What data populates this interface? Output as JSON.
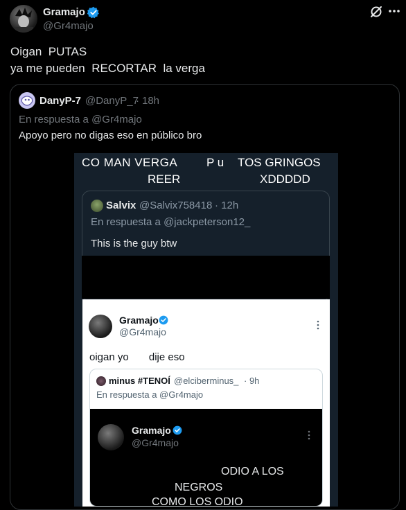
{
  "main_tweet": {
    "author_name": "Gramajo",
    "author_handle": "@Gr4majo",
    "text_line1": "Oigan  PUTAS",
    "text_line2": "ya me pueden  RECORTAR  la verga"
  },
  "quoted_tweet": {
    "author_name": "DanyP-7",
    "author_handle": "@DanyP_7",
    "time_sep": "·",
    "time": "18h",
    "reply_to": "En respuesta a @Gr4majo",
    "text": "Apoyo pero no digas eso en público bro"
  },
  "meme": {
    "caption_left_1": "CO MAN VERGA",
    "caption_left_2": "REER",
    "caption_mid": "P u",
    "caption_right_1": "TOS GRINGOS",
    "caption_right_2": "XDDDDD",
    "reply_tweet": {
      "author_name": "Salvix",
      "author_handle": "@Salvix758418",
      "time": "· 12h",
      "reply_to": "En respuesta a @jackpeterson12_",
      "text": "This is the guy btw"
    },
    "inner_tweet": {
      "author_name": "Gramajo",
      "author_handle": "@Gr4majo",
      "text": "oigan yo       dije eso"
    },
    "inner_quote": {
      "author_name": "minus #TENOÍ",
      "author_handle": "@elciberminus_",
      "time": "· 9h",
      "reply_to": "En respuesta a @Gr4majo"
    },
    "deep_tweet": {
      "author_name": "Gramajo",
      "author_handle": "@Gr4majo",
      "line1": "ODIO A LOS",
      "line2": "NEGROS",
      "line3": "COMO LOS ODIO"
    }
  },
  "icons": [
    "grok-icon",
    "more-options-icon",
    "verified-badge-icon"
  ],
  "colors": {
    "verified": "#1d9bf0",
    "background": "#000000",
    "muted": "#71767b"
  }
}
